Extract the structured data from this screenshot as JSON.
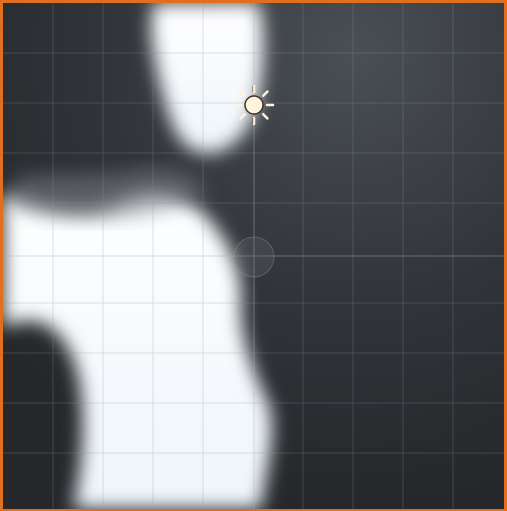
{
  "window": {
    "frame_color": "#e07020",
    "background_color": "#2a2d31"
  },
  "scene": {
    "lit_color": "#f4f9ff",
    "shadow_color": "#2b2e33",
    "grid_color": "#8a96a3",
    "axis_color": "#a8b3be"
  },
  "gizmos": {
    "light": {
      "icon": "sun-icon",
      "color": "#fff3dc"
    },
    "pivot": {
      "icon": "pivot-handle"
    }
  }
}
